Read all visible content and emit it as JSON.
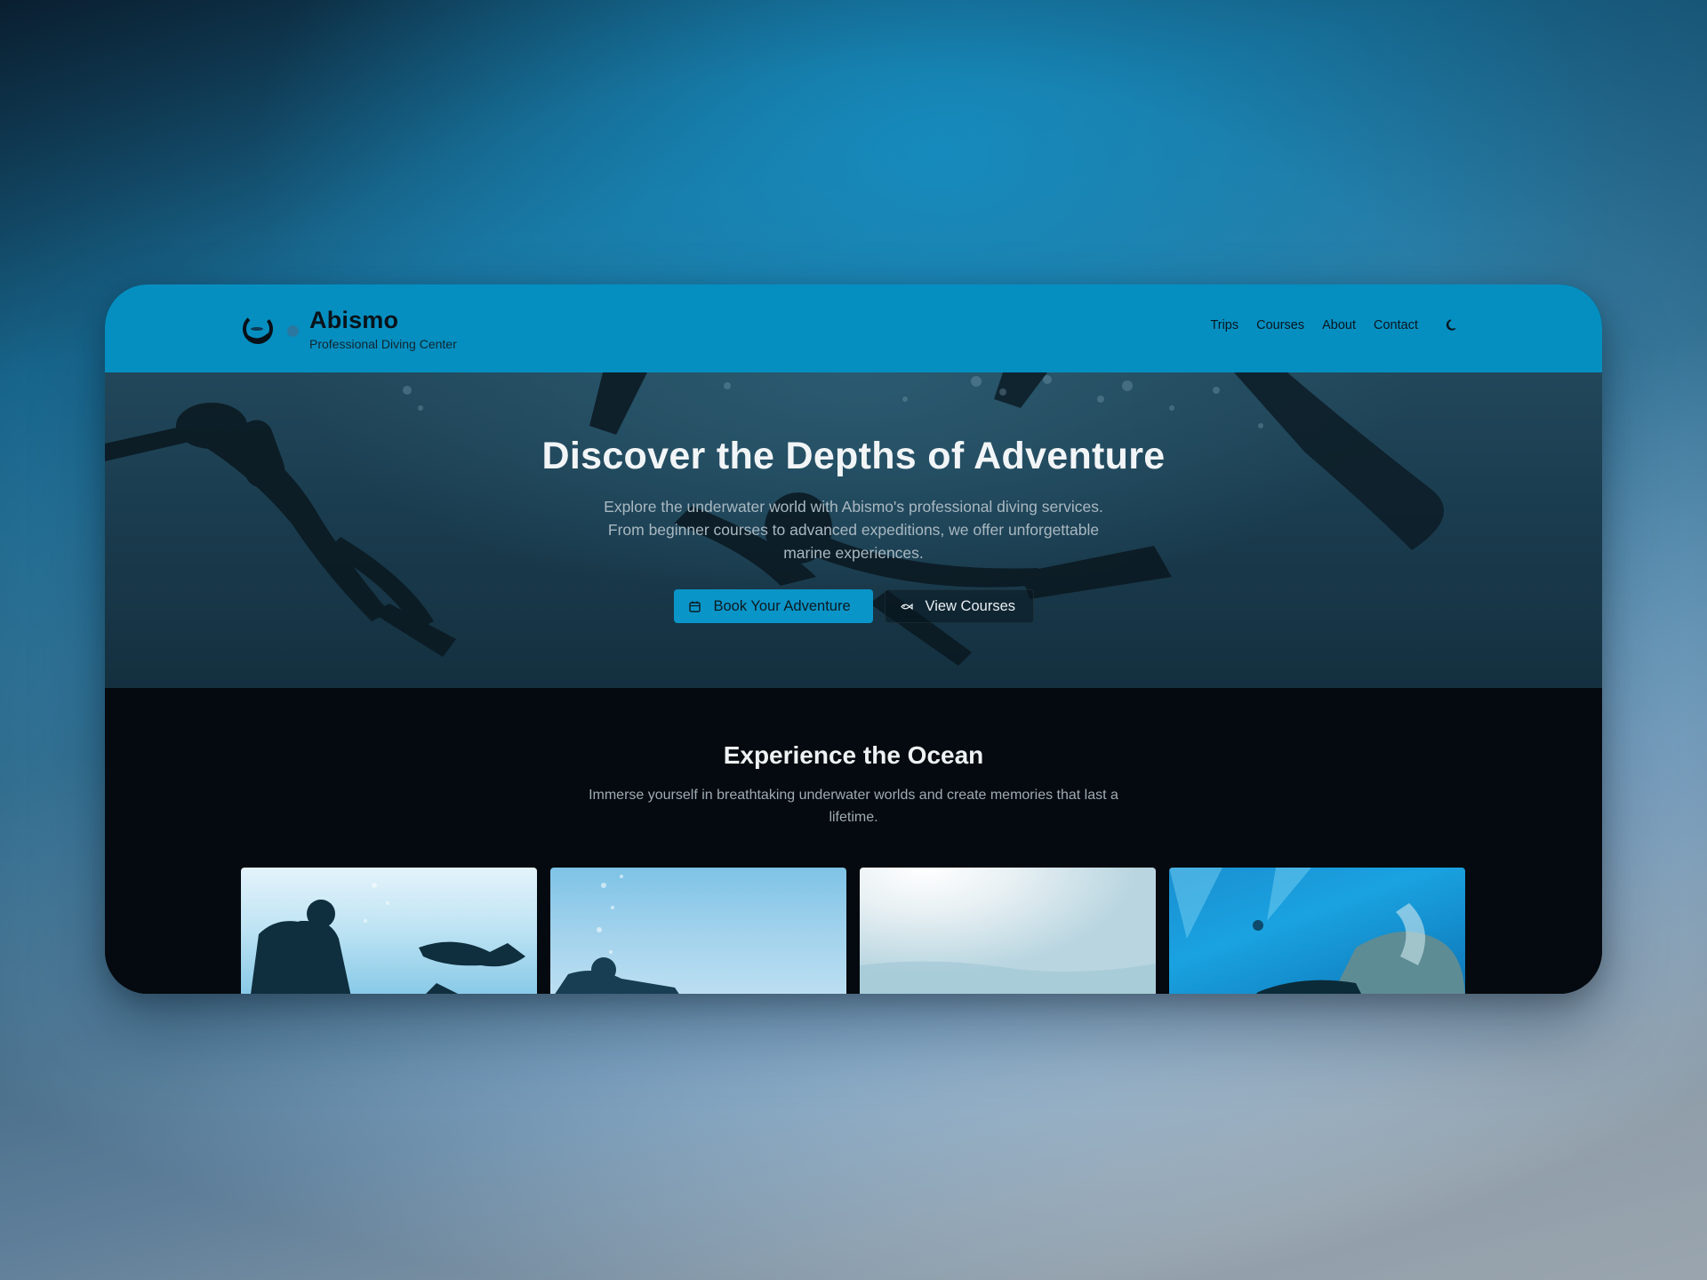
{
  "site": {
    "brand_name": "Abismo",
    "brand_tagline": "Professional Diving Center",
    "header_color": "#058fc0",
    "accent_color": "#0a95c8"
  },
  "nav": {
    "items": [
      {
        "label": "Trips",
        "key": "trips"
      },
      {
        "label": "Courses",
        "key": "courses"
      },
      {
        "label": "About",
        "key": "about"
      },
      {
        "label": "Contact",
        "key": "contact"
      }
    ],
    "theme_toggle_icon": "moon-icon"
  },
  "hero": {
    "title": "Discover the Depths of Adventure",
    "description": "Explore the underwater world with Abismo's professional diving services. From beginner courses to advanced expeditions, we offer unforgettable marine experiences.",
    "primary_button": {
      "label": "Book Your Adventure",
      "icon": "calendar-icon"
    },
    "secondary_button": {
      "label": "View Courses",
      "icon": "fish-icon"
    }
  },
  "experience": {
    "title": "Experience the Ocean",
    "description": "Immerse yourself in breathtaking underwater worlds and create memories that last a lifetime.",
    "gallery": [
      {
        "name": "divers-photo"
      },
      {
        "name": "diver-bubbles-photo"
      },
      {
        "name": "sunlit-surface-photo"
      },
      {
        "name": "sea-lion-photo"
      }
    ]
  }
}
